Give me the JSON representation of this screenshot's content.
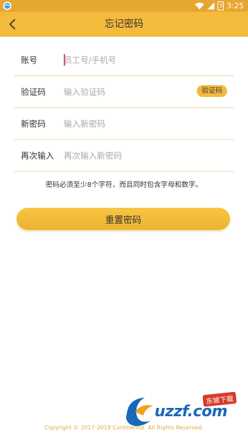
{
  "status_bar": {
    "time": "3:25",
    "battery_level": "3"
  },
  "header": {
    "title": "忘记密码"
  },
  "form": {
    "account": {
      "label": "账号",
      "placeholder": "员工号/手机号",
      "value": ""
    },
    "verify_code": {
      "label": "验证码",
      "placeholder": "输入验证码",
      "value": "",
      "button_label": "验证码"
    },
    "new_password": {
      "label": "新密码",
      "placeholder": "输入新密码",
      "value": ""
    },
    "confirm_password": {
      "label": "再次输入",
      "placeholder": "再次输入新密码",
      "value": ""
    }
  },
  "hint": "密码必须至少8个字符，而且同时包含字母和数字。",
  "reset_button_label": "重置密码",
  "footer": {
    "copyright": "Copyright © 2017-2018 Continental. All Rights Reserved."
  },
  "watermark": {
    "text": "uzzf.com",
    "badge": "东坡下载"
  },
  "colors": {
    "app_bar": "#f4ba3c",
    "status_bar": "#e7a630",
    "accent_caret": "#e24c86",
    "divider": "#ecdca8"
  }
}
